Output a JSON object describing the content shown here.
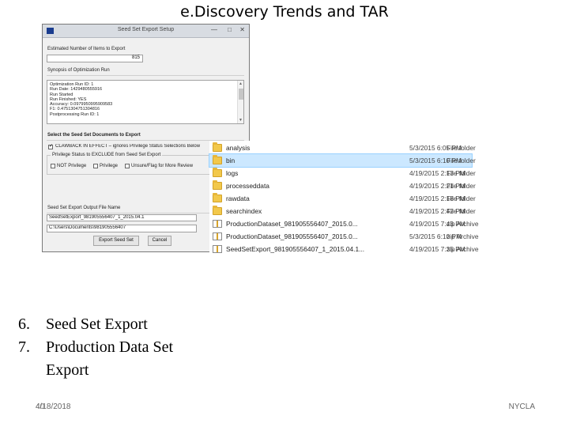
{
  "slide": {
    "title": "e.Discovery Trends and TAR",
    "bullets": [
      {
        "number": "6.",
        "text": "Seed Set Export"
      },
      {
        "number": "7.",
        "text": "Production Data Set Export"
      }
    ],
    "footer": {
      "date": "4/18/2018",
      "slide_number": "40",
      "org": "NYCLA"
    }
  },
  "dialog": {
    "title": "Seed Set Export Setup",
    "estimated_label": "Estimated Number of Items to Export",
    "estimated_value": "815",
    "synopsis_label": "Synopsis of Optimization Run",
    "synopsis_lines": [
      "Optimization Run ID: 1",
      "Run Date: 1429480555916",
      "Run Started",
      "Run Finished: YES",
      "Accuracy: 0.0979950995909583",
      "F1: 0.4751304751304816",
      "Postprocessing Run ID: 1"
    ],
    "select_label": "Select the Seed Set Documents to Export",
    "clawback_label": "CLAWBACK IN EFFECT – ignores Privilege Status Selections Below",
    "privilege_group_label": "Privilege Status to EXCLUDE from Seed Set Export",
    "privilege_options": [
      "NOT Privilege",
      "Privilege",
      "Unsure/Flag for More Review"
    ],
    "output_label": "Seed Set Export Output File Name",
    "output_value": "SeedSetExport_981905556407_1_2015.04.1",
    "path_value": "C:\\Users\\Documents\\981905556407",
    "export_button": "Export Seed Set",
    "cancel_button": "Cancel"
  },
  "files": [
    {
      "name": "analysis",
      "date": "5/3/2015 6:05 PM",
      "type": "File folder",
      "icon": "folder-icon",
      "selected": false
    },
    {
      "name": "bin",
      "date": "5/3/2015 6:10 PM",
      "type": "File folder",
      "icon": "folder-icon",
      "selected": true
    },
    {
      "name": "logs",
      "date": "4/19/2015 2:13 PM",
      "type": "File folder",
      "icon": "folder-icon",
      "selected": false
    },
    {
      "name": "processeddata",
      "date": "4/19/2015 2:21 PM",
      "type": "File folder",
      "icon": "folder-icon",
      "selected": false
    },
    {
      "name": "rawdata",
      "date": "4/19/2015 2:18 PM",
      "type": "File folder",
      "icon": "folder-icon",
      "selected": false
    },
    {
      "name": "searchindex",
      "date": "4/19/2015 2:42 PM",
      "type": "File folder",
      "icon": "folder-icon",
      "selected": false
    },
    {
      "name": "ProductionDataset_981905556407_2015.0...",
      "date": "4/19/2015 7:43 PM",
      "type": "zip Archive",
      "icon": "zip-icon",
      "selected": false
    },
    {
      "name": "ProductionDataset_981905556407_2015.0...",
      "date": "5/3/2015 6:10 PM",
      "type": "zip Archive",
      "icon": "zip-icon",
      "selected": false
    },
    {
      "name": "SeedSetExport_981905556407_1_2015.04.1...",
      "date": "4/19/2015 7:35 PM",
      "type": "zip Archive",
      "icon": "zip-icon",
      "selected": false
    }
  ]
}
